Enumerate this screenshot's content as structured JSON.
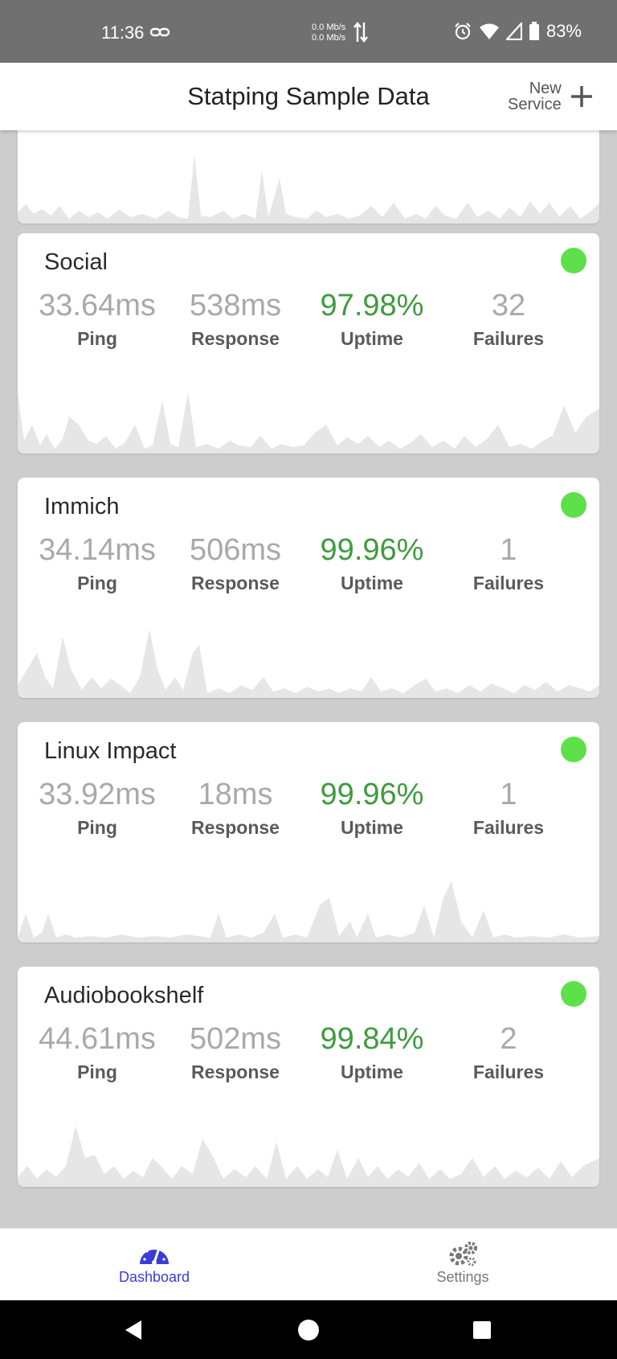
{
  "status_bar": {
    "time": "11:36",
    "net_up": "0.0 Mb/s",
    "net_down": "0.0 Mb/s",
    "battery": "83%"
  },
  "header": {
    "title": "Statping Sample Data",
    "new_service_line1": "New",
    "new_service_line2": "Service"
  },
  "labels": {
    "ping": "Ping",
    "response": "Response",
    "uptime": "Uptime",
    "failures": "Failures"
  },
  "colors": {
    "online": "#5ee04a",
    "uptime": "#3f9b3f",
    "accent": "#3b3bd6"
  },
  "services": [
    {
      "name": "Social",
      "ping": "33.64ms",
      "response": "538ms",
      "uptime": "97.98%",
      "failures": "32",
      "status": "online"
    },
    {
      "name": "Immich",
      "ping": "34.14ms",
      "response": "506ms",
      "uptime": "99.96%",
      "failures": "1",
      "status": "online"
    },
    {
      "name": "Linux Impact",
      "ping": "33.92ms",
      "response": "18ms",
      "uptime": "99.96%",
      "failures": "1",
      "status": "online"
    },
    {
      "name": "Audiobookshelf",
      "ping": "44.61ms",
      "response": "502ms",
      "uptime": "99.84%",
      "failures": "2",
      "status": "online"
    }
  ],
  "bottom_nav": {
    "dashboard": "Dashboard",
    "settings": "Settings"
  }
}
